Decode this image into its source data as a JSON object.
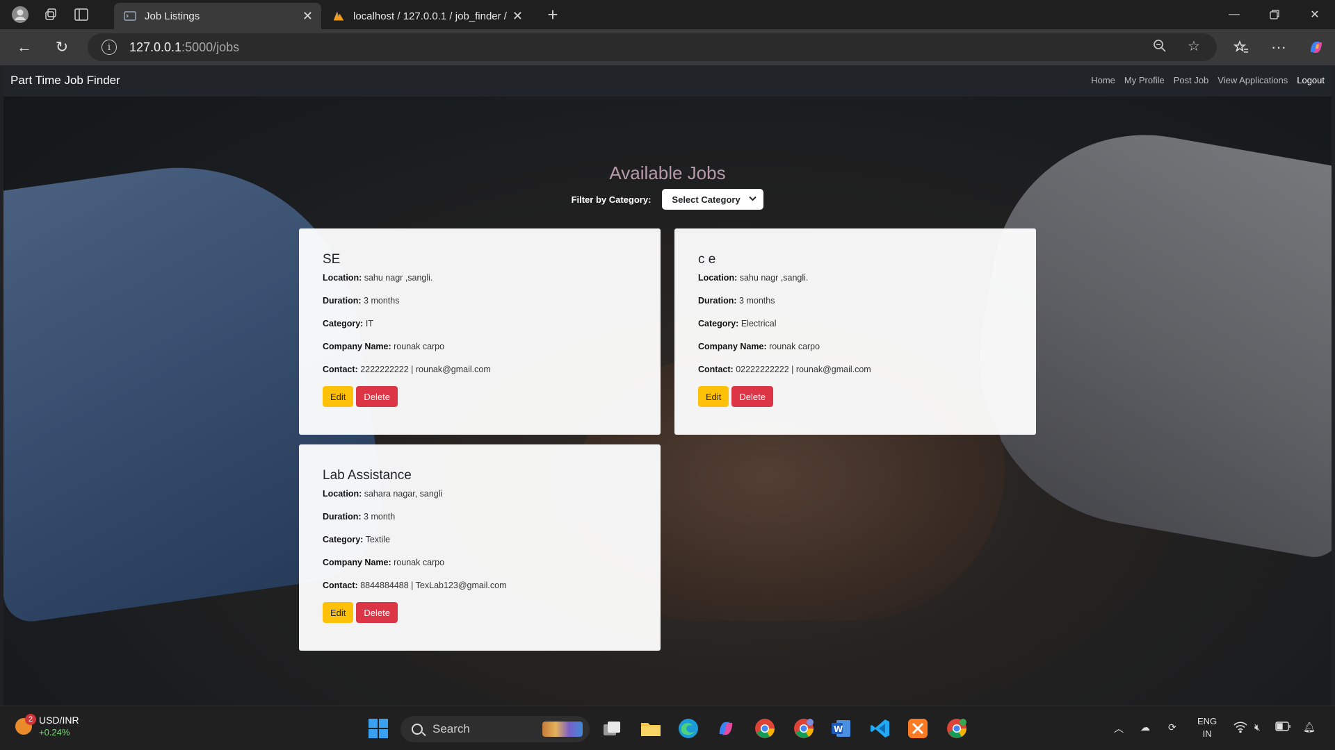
{
  "browser": {
    "tabs": [
      {
        "title": "Job Listings",
        "active": true
      },
      {
        "title": "localhost / 127.0.0.1 / job_finder /",
        "active": false
      }
    ],
    "url_host": "127.0.0.1",
    "url_path": ":5000/jobs"
  },
  "navbar": {
    "brand": "Part Time Job Finder",
    "links": [
      "Home",
      "My Profile",
      "Post Job",
      "View Applications",
      "Logout"
    ]
  },
  "main": {
    "heading": "Available Jobs",
    "filter_label": "Filter by Category:",
    "filter_selected": "Select Category"
  },
  "labels": {
    "location": "Location:",
    "duration": "Duration:",
    "category": "Category:",
    "company": "Company Name:",
    "contact": "Contact:",
    "edit": "Edit",
    "delete": "Delete"
  },
  "jobs": [
    {
      "title": "SE",
      "location": "sahu nagr ,sangli.",
      "duration": "3 months",
      "category": "IT",
      "company": "rounak carpo",
      "contact": "2222222222 | rounak@gmail.com"
    },
    {
      "title": "c e",
      "location": "sahu nagr ,sangli.",
      "duration": "3 months",
      "category": "Electrical",
      "company": "rounak carpo",
      "contact": "02222222222 | rounak@gmail.com"
    },
    {
      "title": "Lab Assistance",
      "location": "sahara nagar, sangli",
      "duration": "3 month",
      "category": "Textile",
      "company": "rounak carpo",
      "contact": "8844884488 | TexLab123@gmail.com"
    }
  ],
  "taskbar": {
    "ticker_name": "USD/INR",
    "ticker_change": "+0.24%",
    "notification_count": "2",
    "search_label": "Search",
    "lang_line1": "ENG",
    "lang_line2": "IN"
  },
  "colors": {
    "edit": "#ffc107",
    "delete": "#dc3545",
    "navbar": "#212529",
    "heading": "#b79aa9"
  }
}
